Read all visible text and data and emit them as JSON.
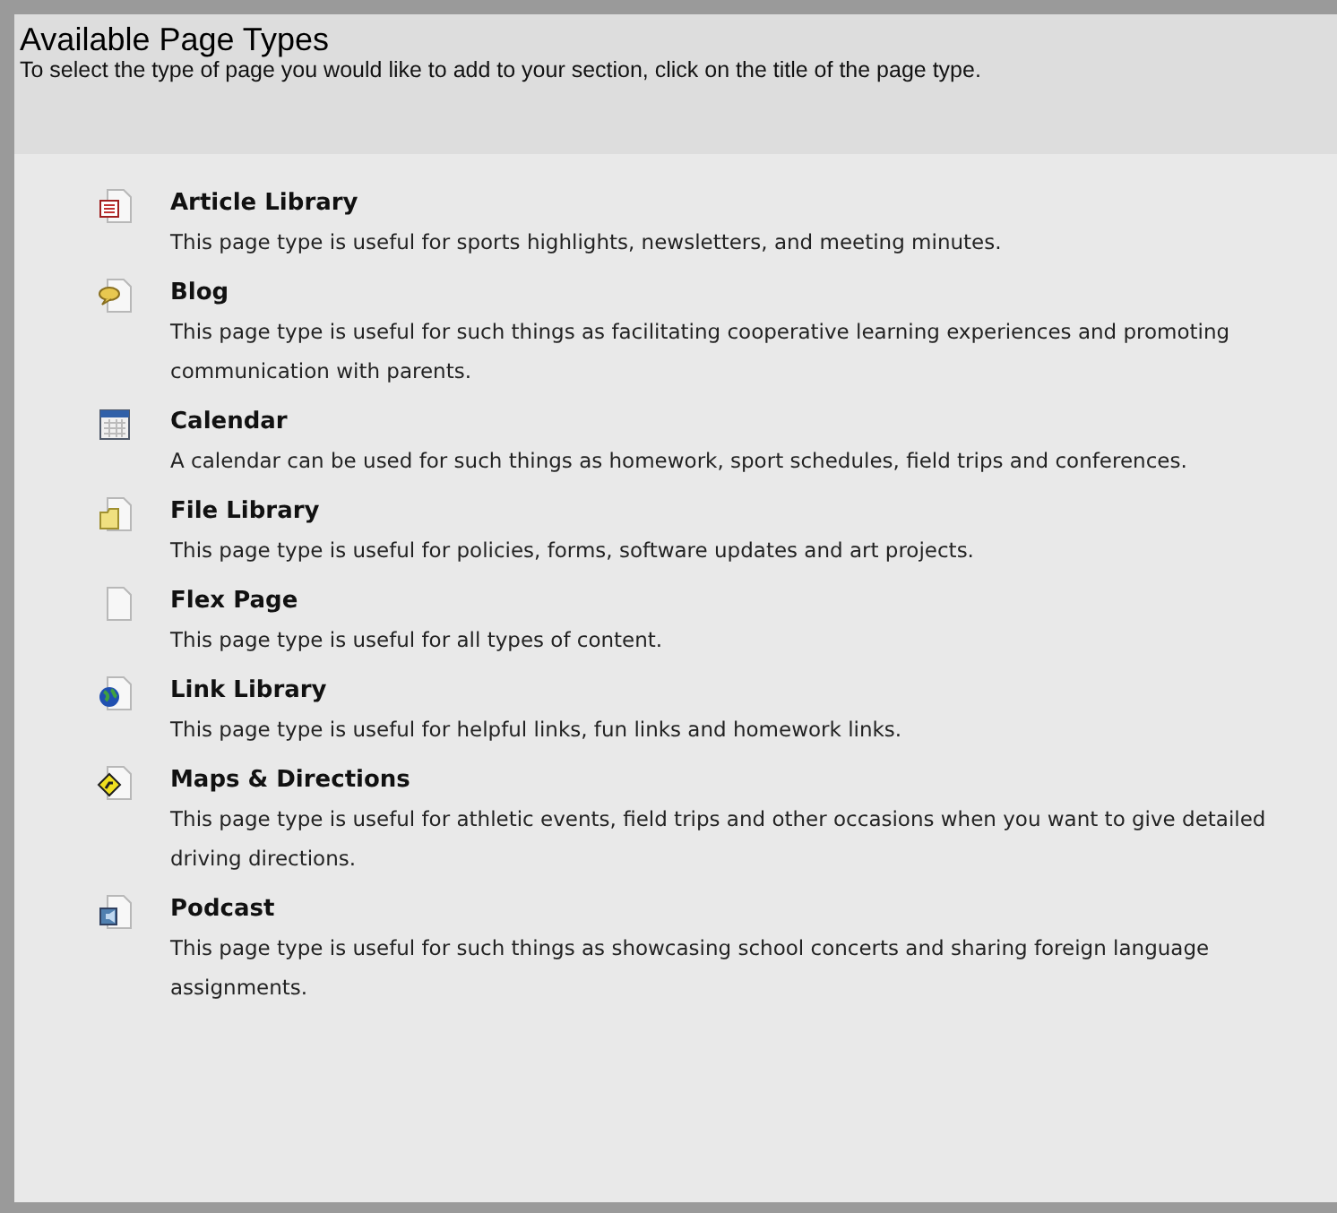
{
  "header": {
    "title": "Available Page Types",
    "instructions": "To select the type of page you would like to add to your section, click on the title of the page type."
  },
  "page_types": [
    {
      "kind": "article",
      "title": "Article Library",
      "description": "This page type is useful for sports highlights, newsletters, and meeting minutes."
    },
    {
      "kind": "blog",
      "title": "Blog",
      "description": "This page type is useful for such things as facilitating cooperative learning experiences and promoting communication with parents."
    },
    {
      "kind": "calendar",
      "title": "Calendar",
      "description": "A calendar can be used for such things as homework, sport schedules, field trips and conferences."
    },
    {
      "kind": "folder",
      "title": "File Library",
      "description": "This page type is useful for policies, forms, software updates and art projects."
    },
    {
      "kind": "blank",
      "title": "Flex Page",
      "description": "This page type is useful for all types of content."
    },
    {
      "kind": "globe",
      "title": "Link Library",
      "description": "This page type is useful for helpful links, fun links and homework links."
    },
    {
      "kind": "sign",
      "title": "Maps & Directions",
      "description": "This page type is useful for athletic events, field trips and other occasions when you want to give detailed driving directions."
    },
    {
      "kind": "podcast",
      "title": "Podcast",
      "description": "This page type is useful for such things as showcasing school concerts and sharing foreign language assignments."
    }
  ]
}
